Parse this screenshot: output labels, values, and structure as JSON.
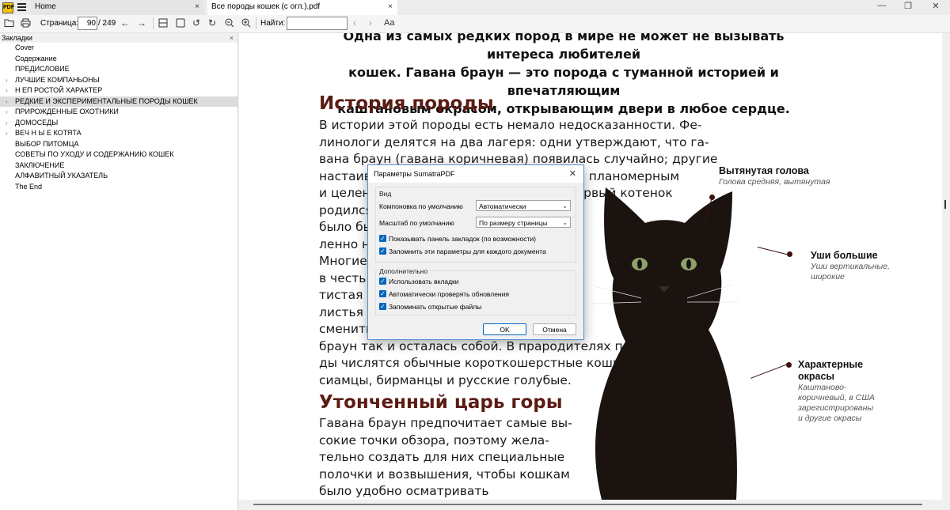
{
  "titlebar": {
    "logo_text": "PDF",
    "tabs": [
      {
        "label": "Home"
      },
      {
        "label": "Все породы кошек (с огл.).pdf"
      }
    ],
    "close_glyph": "×",
    "window_buttons": [
      "—",
      "❐",
      "✕"
    ]
  },
  "toolbar": {
    "page_label": "Страница:",
    "page_current": "90",
    "page_total": "/ 249",
    "find_label": "Найти:",
    "find_value": "",
    "match_case_label": "Aa"
  },
  "sidebar": {
    "title": "Закладки",
    "close_glyph": "×",
    "bookmarks": [
      {
        "label": "Cover",
        "expandable": false
      },
      {
        "label": "Содержание",
        "expandable": false
      },
      {
        "label": "ПРЕДИСЛОВИЕ",
        "expandable": false
      },
      {
        "label": "ЛУЧШИЕ КОМПАНЬОНЫ",
        "expandable": true
      },
      {
        "label": "Н ЕП РОСТОЙ ХАРАКТЕР",
        "expandable": true
      },
      {
        "label": "РЕДКИЕ И ЭКСПЕРИМЕНТАЛЬНЫЕ ПОРОДЫ КОШЕК",
        "expandable": true,
        "selected": true
      },
      {
        "label": "ПРИРОЖДЕННЫЕ ОХОТНИКИ",
        "expandable": true
      },
      {
        "label": "ДОМОСЕДЫ",
        "expandable": true
      },
      {
        "label": "ВЕЧ Н Ы Е КОТЯТА",
        "expandable": true
      },
      {
        "label": "ВЫБОР ПИТОМЦА",
        "expandable": false
      },
      {
        "label": "СОВЕТЫ ПО УХОДУ И СОДЕРЖАНИЮ КОШЕК",
        "expandable": false
      },
      {
        "label": "ЗАКЛЮЧЕНИЕ",
        "expandable": false
      },
      {
        "label": "АЛФАВИТНЫЙ УКАЗАТЕЛЬ",
        "expandable": false
      },
      {
        "label": "The End",
        "expandable": false
      }
    ]
  },
  "document": {
    "lead": [
      "Одна из самых редких пород в мире не может не вызывать интереса любителей",
      "кошек. Гавана браун — это порода с туманной историей и впечатляющим",
      "каштановым окрасом, открывающим двери в любое сердце."
    ],
    "section1_title": "История породы",
    "section1_lines": [
      "В истории этой породы есть немало недосказанности. Фе-",
      "линологи делятся на два лагеря: одни утверждают, что га-",
      "вана браун (гавана коричневая) появилась случайно; другие",
      "настаивают, что ее вывели в результате планомерным",
      "и целенаправленным скрещиваниям. Первый котенок",
      "родился в Англии, как можно",
      "было бы ожидать, в рез-",
      "ленно н                         ар и рома.",
      "Многие                         но именно",
      "в честь з                       льку барха-",
      "тистая ш",
      "листья т                       и попытки",
      "сменить                        о гавана",
      "браун так и осталась собой. В прародителях поро-",
      "ды числятся обычные короткошерстные кошки,",
      "сиамцы, бирманцы и русские голубые."
    ],
    "section2_title": "Утонченный царь горы",
    "section2_lines": [
      "Гавана браун предпочитает самые вы-",
      "сокие точки обзора, поэтому жела-",
      "тельно создать для них специальные",
      "полочки и возвышения, чтобы кошкам",
      "было удобно осматривать"
    ],
    "annotations": [
      {
        "title": "Вытянутая голова",
        "subtitle": [
          "Голова средняя, вытянутая"
        ]
      },
      {
        "title": "Уши большие",
        "subtitle": [
          "Уши вертикальные,",
          "широкие"
        ]
      },
      {
        "title": "Характерные",
        "title2": "окрасы",
        "subtitle": [
          "Каштаново-",
          "коричневый, в США",
          "зарегистрированы",
          "и другие окрасы"
        ]
      }
    ]
  },
  "dialog": {
    "title": "Параметры SumatraPDF",
    "close_glyph": "✕",
    "view_group": "Вид",
    "layout_label": "Компоновка по умолчанию",
    "layout_value": "Автоматически",
    "zoom_label": "Масштаб по умолчанию",
    "zoom_value": "По размеру страницы",
    "checkboxes_view": [
      "Показывать панель закладок (по возможности)",
      "Запомнить эти параметры для каждого документа"
    ],
    "extra_group": "Дополнительно",
    "checkboxes_extra": [
      "Использовать вкладки",
      "Автоматически проверять обновления",
      "Запоминать открытые файлы"
    ],
    "ok_label": "OK",
    "cancel_label": "Отмена"
  },
  "colors": {
    "heading": "#5b1c14",
    "accent": "#0067c0"
  }
}
